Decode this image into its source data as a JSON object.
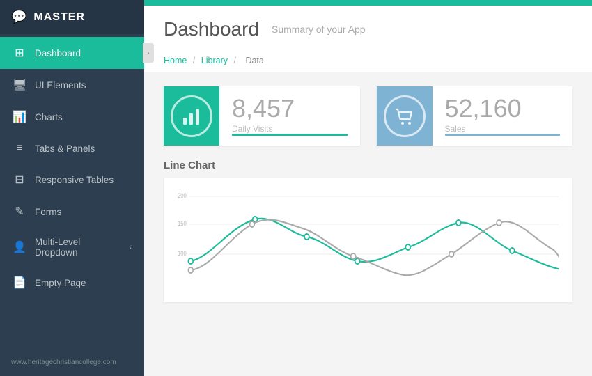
{
  "app": {
    "name": "MASTER",
    "logo_icon": "💬"
  },
  "sidebar": {
    "items": [
      {
        "id": "dashboard",
        "label": "Dashboard",
        "icon": "⊞",
        "active": true,
        "arrow": ""
      },
      {
        "id": "ui-elements",
        "label": "UI Elements",
        "icon": "🖥",
        "active": false,
        "arrow": ""
      },
      {
        "id": "charts",
        "label": "Charts",
        "icon": "📊",
        "active": false,
        "arrow": ""
      },
      {
        "id": "tabs-panels",
        "label": "Tabs & Panels",
        "icon": "≡",
        "active": false,
        "arrow": ""
      },
      {
        "id": "responsive-tables",
        "label": "Responsive Tables",
        "icon": "⊟",
        "active": false,
        "arrow": ""
      },
      {
        "id": "forms",
        "label": "Forms",
        "icon": "✎",
        "active": false,
        "arrow": ""
      },
      {
        "id": "multi-level",
        "label": "Multi-Level Dropdown",
        "icon": "👤",
        "active": false,
        "arrow": "‹"
      },
      {
        "id": "empty-page",
        "label": "Empty Page",
        "icon": "📄",
        "active": false,
        "arrow": ""
      }
    ],
    "footer_text": "www.heritagechristiancollege.com"
  },
  "header": {
    "title": "Dashboard",
    "subtitle": "Summary of your App"
  },
  "breadcrumb": {
    "items": [
      "Home",
      "Library",
      "Data"
    ]
  },
  "stats": [
    {
      "id": "daily-visits",
      "icon": "📊",
      "value": "8,457",
      "label": "Daily Visits",
      "color": "teal"
    },
    {
      "id": "sales",
      "icon": "🛒",
      "value": "52,160",
      "label": "Sales",
      "color": "blue"
    }
  ],
  "chart": {
    "title": "Line Chart",
    "y_labels": [
      "200",
      "150",
      "100"
    ],
    "teal_line": "M0,105 C30,100 60,55 100,45 C130,38 155,65 185,70 C215,75 240,100 270,105 C300,110 325,95 355,85 C385,78 410,55 440,50 C470,45 500,80 530,90 C560,100 590,115 620,118",
    "gray_line": "M0,118 C30,115 60,70 95,52 C125,38 150,50 180,58 C210,66 235,90 265,98 C295,106 320,120 350,125 C375,128 400,110 430,95 C455,82 480,60 510,50 C540,40 570,75 600,88 C625,98 645,130 680,145"
  }
}
